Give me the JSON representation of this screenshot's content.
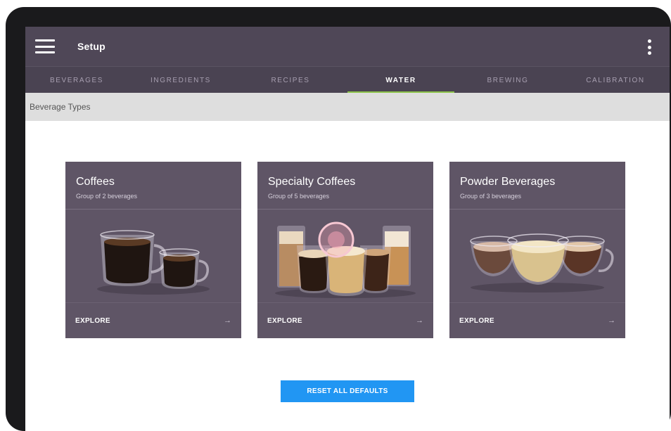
{
  "appbar": {
    "title": "Setup",
    "menu_icon": "hamburger-menu-icon",
    "more_icon": "more-vert-icon"
  },
  "tabs": [
    {
      "label": "BEVERAGES",
      "active": false
    },
    {
      "label": "INGREDIENTS",
      "active": false
    },
    {
      "label": "RECIPES",
      "active": false
    },
    {
      "label": "WATER",
      "active": true
    },
    {
      "label": "BREWING",
      "active": false
    },
    {
      "label": "CALIBRATION",
      "active": false
    }
  ],
  "subheader": {
    "title": "Beverage Types"
  },
  "cards": [
    {
      "title": "Coffees",
      "subtitle": "Group of 2 beverages",
      "action": "EXPLORE",
      "arrow": "→"
    },
    {
      "title": "Specialty Coffees",
      "subtitle": "Group of 5 beverages",
      "action": "EXPLORE",
      "arrow": "→"
    },
    {
      "title": "Powder Beverages",
      "subtitle": "Group of 3 beverages",
      "action": "EXPLORE",
      "arrow": "→"
    }
  ],
  "reset_button": {
    "label": "RESET ALL DEFAULTS"
  },
  "colors": {
    "appbar": "#4f4757",
    "tab_indicator": "#8bc34a",
    "card": "#5f5566",
    "button": "#2196f3"
  }
}
